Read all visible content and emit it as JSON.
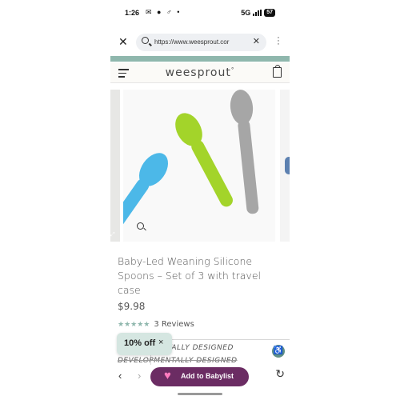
{
  "status_bar": {
    "time": "1:26",
    "left_icons": "✉ ● ♂ •",
    "network": "5G",
    "battery": "57"
  },
  "browser": {
    "url": "https://www.weesprout.cor",
    "close_icon": "close-icon",
    "menu_icon": "more-vert-icon"
  },
  "site": {
    "logo": "weesprout",
    "logo_mark": "°"
  },
  "product": {
    "title": "Baby-Led Weaning Silicone Spoons – Set of 3 with travel case",
    "price": "$9.98",
    "stars": "★★★★★",
    "reviews": "3 Reviews",
    "feature_line_1": "NTALLY DESIGNED",
    "feature_line_2": "DEVELOPMENTALLY DESIGNED",
    "spoon_colors": [
      "#4cb8e8",
      "#a3d42a",
      "#a6a6a6"
    ]
  },
  "discount_popup": {
    "label": "10% off",
    "close": "×"
  },
  "bottom_nav": {
    "back": "‹",
    "forward": "›",
    "babylist_heart": "♥",
    "babylist_label": "Add to Babylist",
    "reload": "↻"
  }
}
